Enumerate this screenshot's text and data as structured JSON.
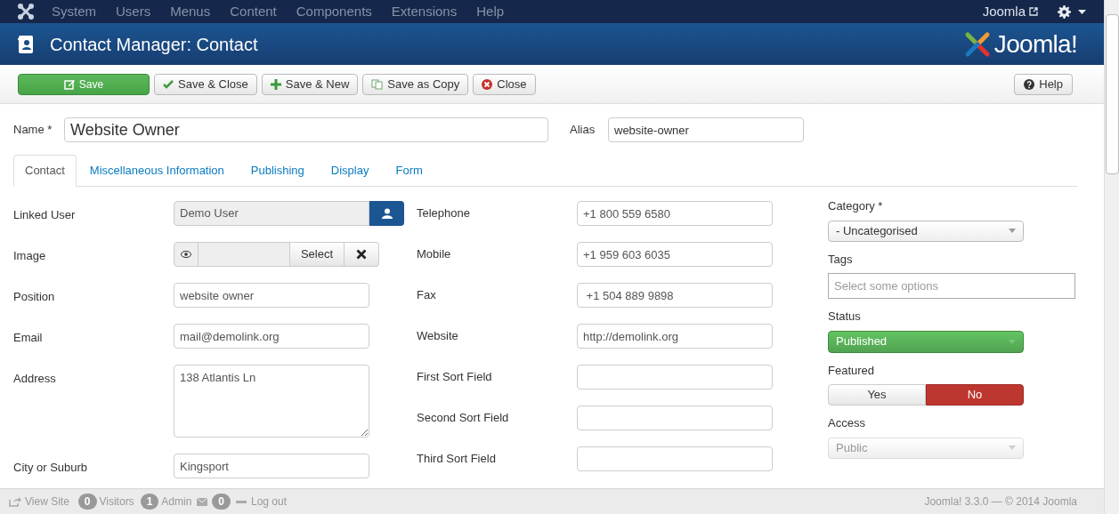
{
  "menu": [
    "System",
    "Users",
    "Menus",
    "Content",
    "Components",
    "Extensions",
    "Help"
  ],
  "user_menu": {
    "site": "Joomla"
  },
  "header": {
    "title": "Contact Manager: Contact",
    "logo_text": "Joomla!"
  },
  "toolbar": [
    {
      "label": "Save",
      "kind": "save"
    },
    {
      "label": "Save & Close",
      "kind": "check"
    },
    {
      "label": "Save & New",
      "kind": "new"
    },
    {
      "label": "Save as Copy",
      "kind": "copy"
    },
    {
      "label": "Close",
      "kind": "close"
    }
  ],
  "help_button": "Help",
  "name_field": {
    "label": "Name *",
    "value": "Website Owner"
  },
  "alias_field": {
    "label": "Alias",
    "value": "website-owner"
  },
  "tabs": [
    {
      "label": "Contact",
      "selected": true
    },
    {
      "label": "Miscellaneous Information",
      "selected": false
    },
    {
      "label": "Publishing",
      "selected": false
    },
    {
      "label": "Display",
      "selected": false
    },
    {
      "label": "Form",
      "selected": false
    }
  ],
  "left_fields": [
    {
      "label": "Linked User",
      "kind": "user",
      "value": "Demo User"
    },
    {
      "label": "Image",
      "kind": "media",
      "button": "Select"
    },
    {
      "label": "Position",
      "kind": "text",
      "value": "website owner"
    },
    {
      "label": "Email",
      "kind": "text",
      "value": "mail@demolink.org"
    },
    {
      "label": "Address",
      "kind": "textarea",
      "value": "138 Atlantis Ln"
    },
    {
      "label": "City or Suburb",
      "kind": "text",
      "value": "Kingsport"
    }
  ],
  "middle_fields": [
    {
      "label": "Telephone",
      "value": "+1 800 559 6580"
    },
    {
      "label": "Mobile",
      "value": "+1 959 603 6035"
    },
    {
      "label": "Fax",
      "value": " +1 504 889 9898"
    },
    {
      "label": "Website",
      "value": "http://demolink.org"
    },
    {
      "label": "First Sort Field"
    },
    {
      "label": "Second Sort Field"
    },
    {
      "label": "Third Sort Field"
    }
  ],
  "right_fields": [
    {
      "label": "Category *",
      "kind": "select",
      "value": "- Uncategorised",
      "disabled": false
    },
    {
      "label": "Tags",
      "kind": "tags",
      "placeholder": "Select some options"
    },
    {
      "label": "Status",
      "kind": "status",
      "value": "Published"
    },
    {
      "label": "Featured",
      "kind": "toggle",
      "options": [
        {
          "label": "Yes",
          "selected": false
        },
        {
          "label": "No",
          "selected": true
        }
      ]
    },
    {
      "label": "Access",
      "kind": "select",
      "value": "Public",
      "disabled": true
    }
  ],
  "footer": {
    "view_site": "View Site",
    "visitors_count": "0",
    "visitors": "Visitors",
    "admin_count": "1",
    "admin": "Admin",
    "messages_count": "0",
    "logout": "Log out",
    "version": "Joomla! 3.3.0 — © 2014 Joomla"
  }
}
